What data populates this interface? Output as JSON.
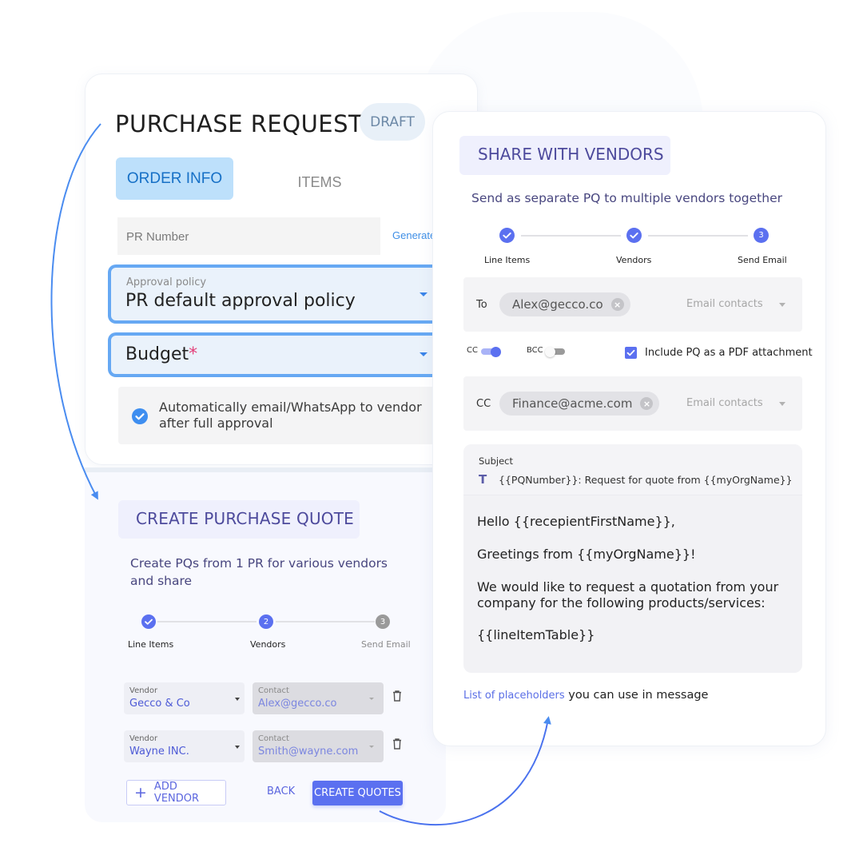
{
  "purchase_request": {
    "title": "PURCHASE REQUESTS",
    "status_badge": "DRAFT",
    "tabs": [
      {
        "label": "ORDER INFO",
        "active": true
      },
      {
        "label": "ITEMS",
        "active": false
      }
    ],
    "pr_number": {
      "placeholder": "PR Number",
      "value": ""
    },
    "generate_link": "Generate",
    "approval_policy": {
      "label": "Approval policy",
      "value": "PR default approval policy"
    },
    "budget": {
      "label": "Budget",
      "required_marker": "*",
      "value": ""
    },
    "auto_send": {
      "checked": true,
      "label": "Automatically email/WhatsApp to vendor after full approval"
    }
  },
  "create_purchase_quote": {
    "title": "CREATE PURCHASE QUOTE",
    "description": "Create PQs from 1 PR for various vendors and share",
    "steps": [
      {
        "label": "Line Items",
        "state": "done",
        "marker": "✓"
      },
      {
        "label": "Vendors",
        "state": "current",
        "marker": "2"
      },
      {
        "label": "Send Email",
        "state": "pending",
        "marker": "3"
      }
    ],
    "vendors": [
      {
        "vendor_label": "Vendor",
        "vendor": "Gecco & Co",
        "contact_label": "Contact",
        "contact": "Alex@gecco.co"
      },
      {
        "vendor_label": "Vendor",
        "vendor": "Wayne INC.",
        "contact_label": "Contact",
        "contact": "Smith@wayne.com"
      }
    ],
    "add_vendor_label": "ADD VENDOR",
    "back_label": "BACK",
    "create_quotes_label": "CREATE QUOTES"
  },
  "share_with_vendors": {
    "title": "SHARE WITH VENDORS",
    "description": "Send as separate PQ to multiple vendors together",
    "steps": [
      {
        "label": "Line Items",
        "state": "done",
        "marker": "✓"
      },
      {
        "label": "Vendors",
        "state": "done",
        "marker": "✓"
      },
      {
        "label": "Send Email",
        "state": "current",
        "marker": "3"
      }
    ],
    "to": {
      "label": "To",
      "chip": "Alex@gecco.co",
      "placeholder": "Email contacts"
    },
    "cc_toggle": {
      "label": "CC",
      "on": true
    },
    "bcc_toggle": {
      "label": "BCC",
      "on": false
    },
    "include_pdf": {
      "checked": true,
      "label": "Include PQ as a PDF attachment"
    },
    "cc": {
      "label": "CC",
      "chip": "Finance@acme.com",
      "placeholder": "Email contacts"
    },
    "subject": {
      "label": "Subject",
      "icon": "T",
      "value": "{{PQNumber}}: Request for quote from {{myOrgName}}"
    },
    "body": [
      "Hello {{recepientFirstName}},",
      "Greetings from {{myOrgName}}!",
      "We would like to request a quotation from your company for the following products/services:",
      "{{lineItemTable}}"
    ],
    "placeholders_link": "List of placeholders",
    "placeholders_suffix": " you can use in message"
  },
  "colors": {
    "primary": "#5b70f0",
    "info_blue": "#66a8f3",
    "title_purple": "#4d4a9c",
    "arrow_blue": "#4a8cf0"
  }
}
